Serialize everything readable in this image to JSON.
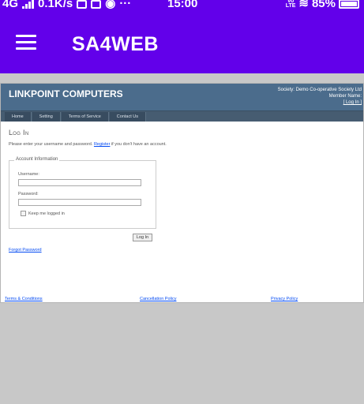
{
  "statusbar": {
    "network": "4G",
    "speed": "0.1K/s",
    "more": "···",
    "time": "15:00",
    "volte": "VoLTE",
    "battery": "85%"
  },
  "appbar": {
    "title": "SA4WEB"
  },
  "site": {
    "title": "LINKPOINT COMPUTERS",
    "society": "Society: Demo Co-operative Society Ltd",
    "member": "Member Name:",
    "login_link": "[ Log In ]",
    "nav": [
      "Home",
      "Setting",
      "Terms of Service",
      "Contact Us"
    ]
  },
  "login": {
    "heading": "Log In",
    "intro_before": "Please enter your username and password.",
    "register_link": "Register",
    "intro_after": "if you don't have an account.",
    "legend": "Account Information",
    "username_label": "Username:",
    "username_value": "",
    "password_label": "Password:",
    "password_value": "",
    "remember_label": "Keep me logged in",
    "remember_checked": false,
    "submit_label": "Log In",
    "forgot_link": "Forgot Password"
  },
  "footer": {
    "terms": "Terms & Conditions",
    "cancellation": "Cancellation Policy",
    "privacy": "Privacy Policy"
  }
}
